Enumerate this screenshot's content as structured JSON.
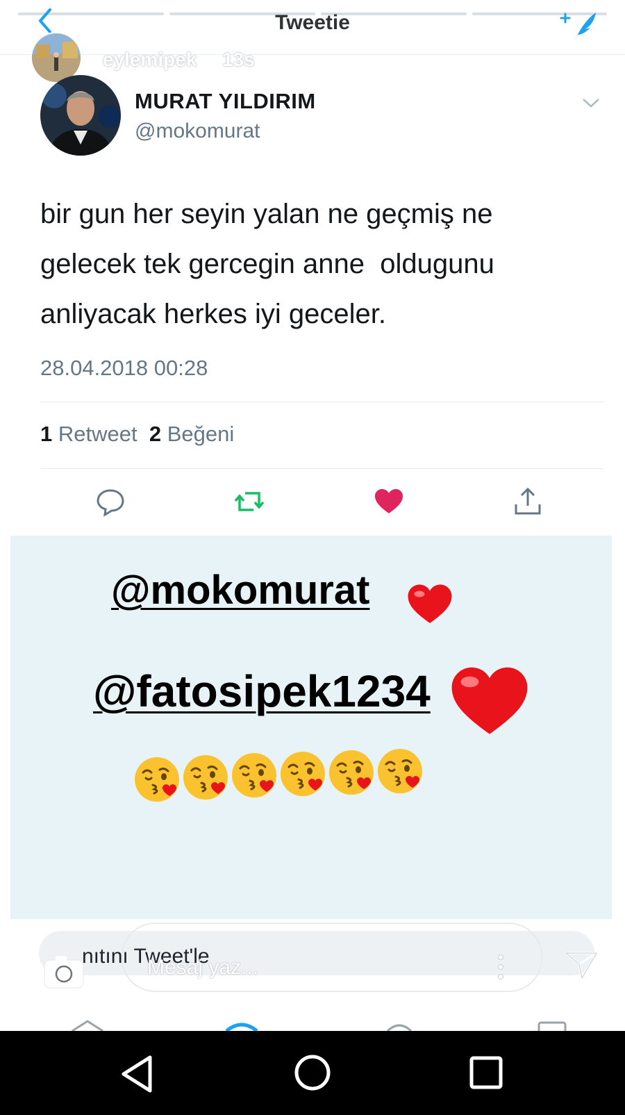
{
  "header": {
    "title": "Tweetie",
    "story_user": "eylemipek",
    "story_time": "13s"
  },
  "tweet": {
    "author_name": "MURAT YILDIRIM",
    "author_handle": "@mokomurat",
    "text_lines": [
      "bir gun her seyin yalan ne geçmiş ne",
      "gelecek tek gercegin anne  oldugunu",
      "anliyacak herkes iyi geceler."
    ],
    "timestamp": "28.04.2018 00:28",
    "retweet_count": "1",
    "retweet_label": "Retweet",
    "like_count": "2",
    "like_label": "Beğeni"
  },
  "story_overlay": {
    "mention_1": "@mokomurat",
    "mention_2": "@fatosipek1234",
    "kiss_emoji_count": 6
  },
  "message_bar": {
    "reply_text": "nıtını Tweet'le",
    "placeholder": "Mesaj yaz..."
  },
  "colors": {
    "retweet_green": "#17bf63",
    "like_red": "#e0245e",
    "twitter_blue": "#1da1f2",
    "overlay_bg": "#e7f3f6"
  },
  "icons": [
    "back-chevron-icon",
    "compose-tweet-icon",
    "dropdown-caret-icon",
    "reply-icon",
    "retweet-icon",
    "like-heart-icon",
    "share-icon",
    "heart-emoji",
    "kissing-face-emoji",
    "camera-icon",
    "more-dots-icon",
    "send-icon",
    "android-back-icon",
    "android-home-icon",
    "android-recents-icon"
  ]
}
